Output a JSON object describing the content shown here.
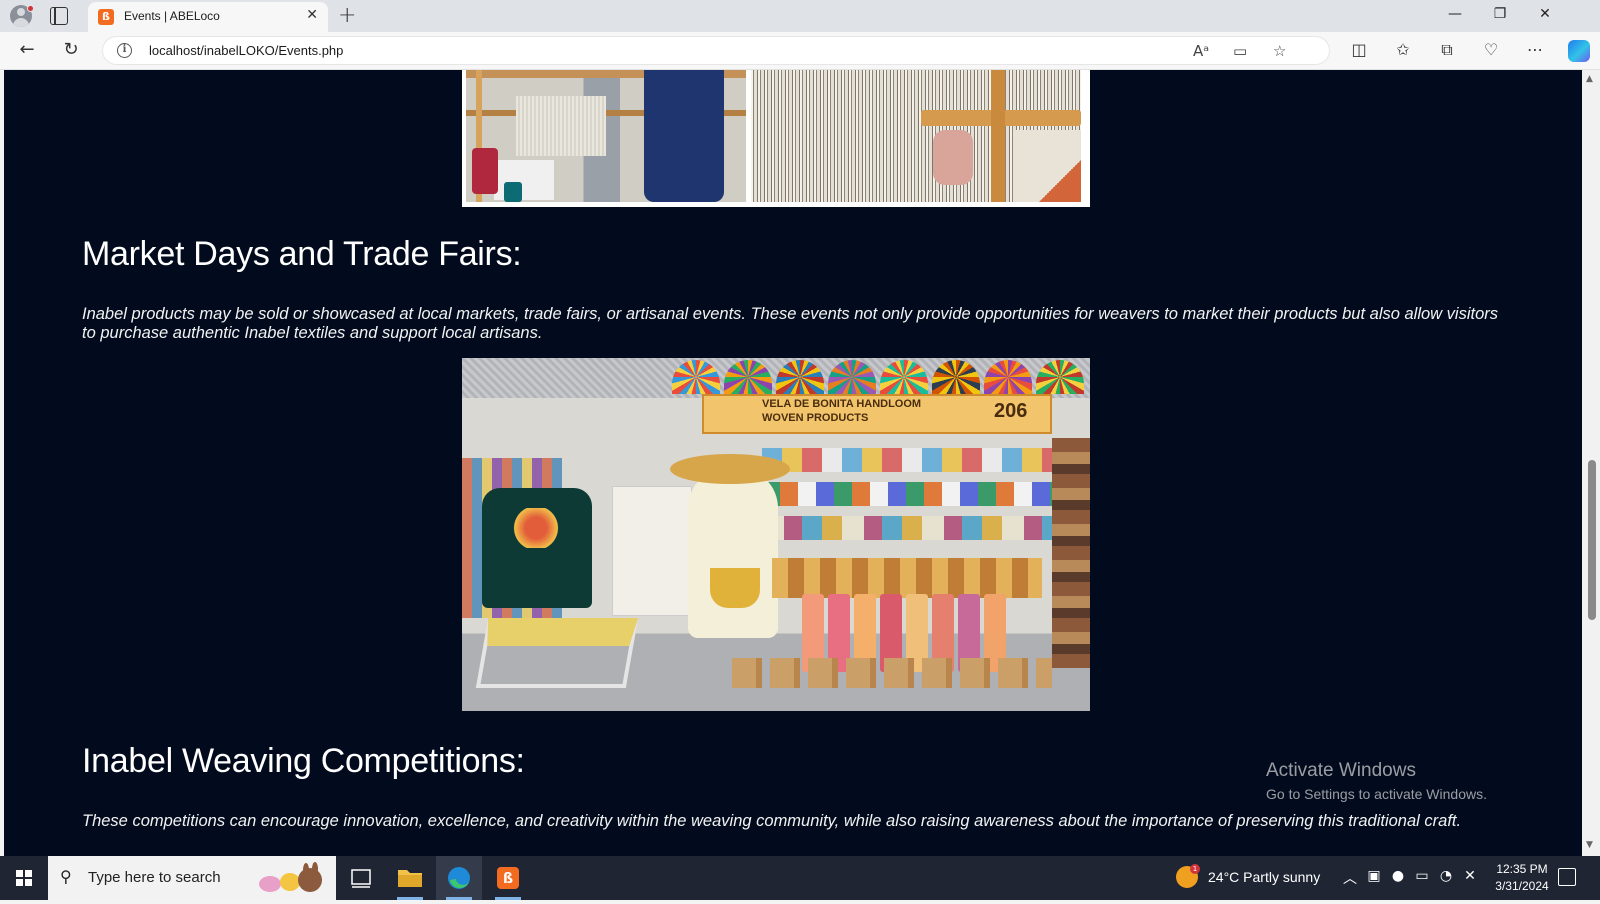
{
  "browser": {
    "tab_title": "Events | ABELoco",
    "tab_close": "✕",
    "new_tab": "+",
    "url": "localhost/inabelLOKO/Events.php",
    "window_controls": {
      "minimize": "—",
      "restore": "❐",
      "close": "✕"
    }
  },
  "page": {
    "background": "#020b1d",
    "sections": [
      {
        "title": "Market Days and Trade Fairs:",
        "text": "Inabel products may be sold or showcased at local markets, trade fairs, or artisanal events. These events not only provide opportunities for weavers to market their products but also allow visitors to purchase authentic Inabel textiles and support local artisans."
      },
      {
        "title": "Inabel Weaving Competitions:",
        "text": "These competitions can encourage innovation, excellence, and creativity within the weaving community, while also raising awareness about the importance of preserving this traditional craft."
      }
    ],
    "booth_sign": {
      "line1": "VELA DE BONITA HANDLOOM",
      "line2": "WOVEN PRODUCTS",
      "number": "206"
    }
  },
  "watermark": {
    "title": "Activate Windows",
    "subtitle": "Go to Settings to activate Windows."
  },
  "taskbar": {
    "search_placeholder": "Type here to search",
    "weather": "24°C  Partly sunny",
    "weather_badge": "1",
    "time": "12:35 PM",
    "date": "3/31/2024"
  },
  "colors": {
    "accent": "#f26b21",
    "taskbar": "#1f2533",
    "page_bg": "#020b1d"
  }
}
